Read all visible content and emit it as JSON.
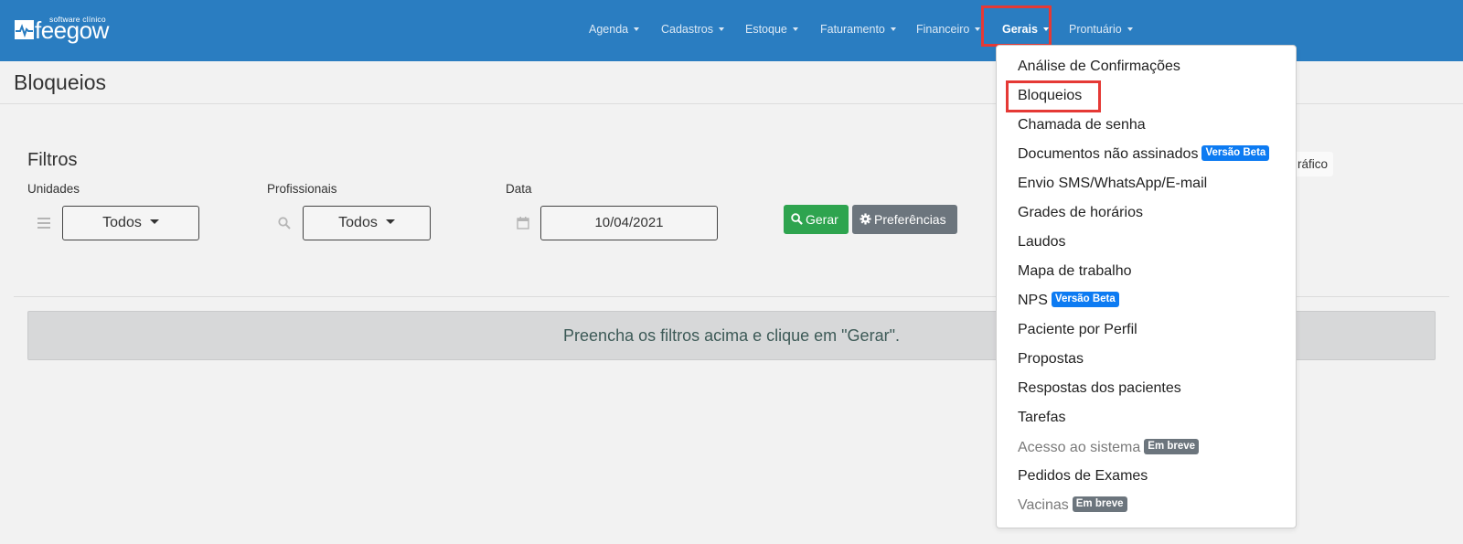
{
  "brand": {
    "tagline": "software clínico",
    "name": "feegow"
  },
  "nav": {
    "items": [
      {
        "label": "Agenda"
      },
      {
        "label": "Cadastros"
      },
      {
        "label": "Estoque"
      },
      {
        "label": "Faturamento"
      },
      {
        "label": "Financeiro"
      },
      {
        "label": "Gerais"
      },
      {
        "label": "Prontuário"
      }
    ],
    "active": "Gerais"
  },
  "page": {
    "title": "Bloqueios"
  },
  "filters": {
    "title": "Filtros",
    "unidades": {
      "label": "Unidades",
      "value": "Todos",
      "icon": "list-icon"
    },
    "profissionais": {
      "label": "Profissionais",
      "value": "Todos",
      "icon": "search-icon"
    },
    "data": {
      "label": "Data",
      "value": "10/04/2021",
      "icon": "calendar-icon"
    },
    "gerar_label": "Gerar",
    "preferencias_label": "Preferências",
    "grafico_label": "ráfico"
  },
  "info": {
    "message": "Preencha os filtros acima e clique em \"Gerar\"."
  },
  "dropdown": {
    "items": [
      {
        "label": "Análise de Confirmações"
      },
      {
        "label": "Bloqueios"
      },
      {
        "label": "Chamada de senha"
      },
      {
        "label": "Documentos não assinados",
        "badge": "Versão Beta"
      },
      {
        "label": "Envio SMS/WhatsApp/E-mail"
      },
      {
        "label": "Grades de horários"
      },
      {
        "label": "Laudos"
      },
      {
        "label": "Mapa de trabalho"
      },
      {
        "label": "NPS",
        "badge": "Versão Beta"
      },
      {
        "label": "Paciente por Perfil"
      },
      {
        "label": "Propostas"
      },
      {
        "label": "Respostas dos pacientes"
      },
      {
        "label": "Tarefas"
      },
      {
        "label": "Acesso ao sistema",
        "badge": "Em breve"
      },
      {
        "label": "Pedidos de Exames"
      },
      {
        "label": "Vacinas",
        "badge": "Em breve"
      }
    ]
  },
  "colors": {
    "navbar": "#2a7dc1",
    "highlight": "#e53935",
    "success": "#2ea44f",
    "secondary": "#6c757d",
    "beta_badge": "#0d7bf2"
  }
}
